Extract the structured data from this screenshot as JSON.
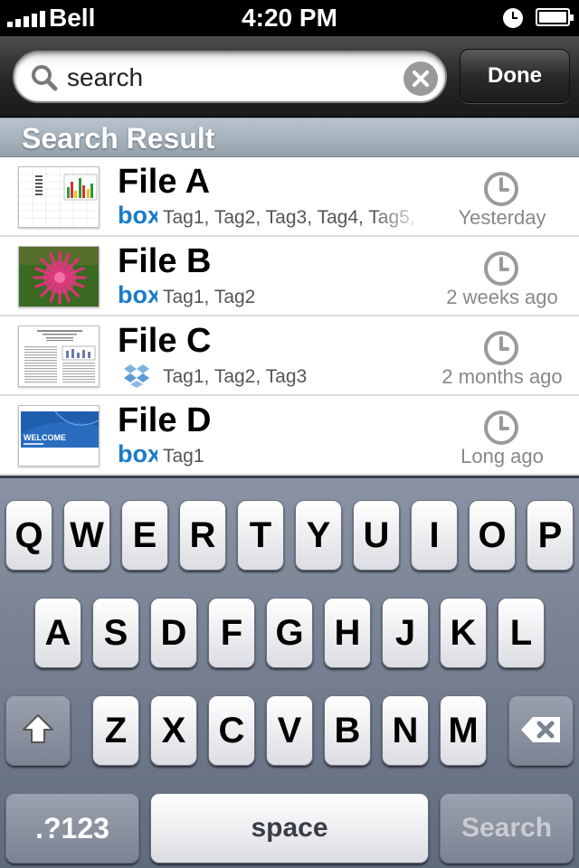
{
  "status_bar": {
    "carrier": "Bell",
    "time": "4:20 PM"
  },
  "search": {
    "value": "search",
    "done_label": "Done"
  },
  "section_header": "Search Result",
  "results": [
    {
      "name": "File A",
      "source": "box",
      "tags": "Tag1, Tag2, Tag3, Tag4, Tag5,",
      "when": "Yesterday"
    },
    {
      "name": "File B",
      "source": "box",
      "tags": "Tag1, Tag2",
      "when": "2 weeks ago"
    },
    {
      "name": "File C",
      "source": "dropbox",
      "tags": "Tag1, Tag2, Tag3",
      "when": "2 months ago"
    },
    {
      "name": "File D",
      "source": "box",
      "tags": "Tag1",
      "when": "Long ago"
    }
  ],
  "source_labels": {
    "box": "box"
  },
  "thumbnail_texts": {
    "welcome": "WELCOME"
  },
  "keyboard": {
    "row1": [
      "Q",
      "W",
      "E",
      "R",
      "T",
      "Y",
      "U",
      "I",
      "O",
      "P"
    ],
    "row2": [
      "A",
      "S",
      "D",
      "F",
      "G",
      "H",
      "J",
      "K",
      "L"
    ],
    "row3": [
      "Z",
      "X",
      "C",
      "V",
      "B",
      "N",
      "M"
    ],
    "numbers_label": ".?123",
    "space_label": "space",
    "search_label": "Search"
  },
  "colors": {
    "box_blue": "#1a7bc9",
    "header_text": "#ffffff",
    "status_bg": "#000000"
  }
}
